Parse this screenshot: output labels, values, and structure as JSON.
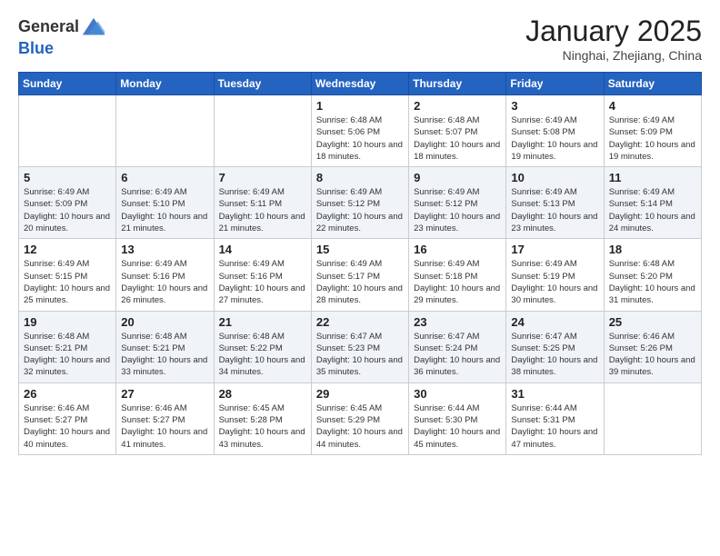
{
  "header": {
    "logo_general": "General",
    "logo_blue": "Blue",
    "month_title": "January 2025",
    "location": "Ninghai, Zhejiang, China"
  },
  "days_of_week": [
    "Sunday",
    "Monday",
    "Tuesday",
    "Wednesday",
    "Thursday",
    "Friday",
    "Saturday"
  ],
  "weeks": [
    [
      {
        "day": "",
        "info": ""
      },
      {
        "day": "",
        "info": ""
      },
      {
        "day": "",
        "info": ""
      },
      {
        "day": "1",
        "info": "Sunrise: 6:48 AM\nSunset: 5:06 PM\nDaylight: 10 hours and 18 minutes."
      },
      {
        "day": "2",
        "info": "Sunrise: 6:48 AM\nSunset: 5:07 PM\nDaylight: 10 hours and 18 minutes."
      },
      {
        "day": "3",
        "info": "Sunrise: 6:49 AM\nSunset: 5:08 PM\nDaylight: 10 hours and 19 minutes."
      },
      {
        "day": "4",
        "info": "Sunrise: 6:49 AM\nSunset: 5:09 PM\nDaylight: 10 hours and 19 minutes."
      }
    ],
    [
      {
        "day": "5",
        "info": "Sunrise: 6:49 AM\nSunset: 5:09 PM\nDaylight: 10 hours and 20 minutes."
      },
      {
        "day": "6",
        "info": "Sunrise: 6:49 AM\nSunset: 5:10 PM\nDaylight: 10 hours and 21 minutes."
      },
      {
        "day": "7",
        "info": "Sunrise: 6:49 AM\nSunset: 5:11 PM\nDaylight: 10 hours and 21 minutes."
      },
      {
        "day": "8",
        "info": "Sunrise: 6:49 AM\nSunset: 5:12 PM\nDaylight: 10 hours and 22 minutes."
      },
      {
        "day": "9",
        "info": "Sunrise: 6:49 AM\nSunset: 5:12 PM\nDaylight: 10 hours and 23 minutes."
      },
      {
        "day": "10",
        "info": "Sunrise: 6:49 AM\nSunset: 5:13 PM\nDaylight: 10 hours and 23 minutes."
      },
      {
        "day": "11",
        "info": "Sunrise: 6:49 AM\nSunset: 5:14 PM\nDaylight: 10 hours and 24 minutes."
      }
    ],
    [
      {
        "day": "12",
        "info": "Sunrise: 6:49 AM\nSunset: 5:15 PM\nDaylight: 10 hours and 25 minutes."
      },
      {
        "day": "13",
        "info": "Sunrise: 6:49 AM\nSunset: 5:16 PM\nDaylight: 10 hours and 26 minutes."
      },
      {
        "day": "14",
        "info": "Sunrise: 6:49 AM\nSunset: 5:16 PM\nDaylight: 10 hours and 27 minutes."
      },
      {
        "day": "15",
        "info": "Sunrise: 6:49 AM\nSunset: 5:17 PM\nDaylight: 10 hours and 28 minutes."
      },
      {
        "day": "16",
        "info": "Sunrise: 6:49 AM\nSunset: 5:18 PM\nDaylight: 10 hours and 29 minutes."
      },
      {
        "day": "17",
        "info": "Sunrise: 6:49 AM\nSunset: 5:19 PM\nDaylight: 10 hours and 30 minutes."
      },
      {
        "day": "18",
        "info": "Sunrise: 6:48 AM\nSunset: 5:20 PM\nDaylight: 10 hours and 31 minutes."
      }
    ],
    [
      {
        "day": "19",
        "info": "Sunrise: 6:48 AM\nSunset: 5:21 PM\nDaylight: 10 hours and 32 minutes."
      },
      {
        "day": "20",
        "info": "Sunrise: 6:48 AM\nSunset: 5:21 PM\nDaylight: 10 hours and 33 minutes."
      },
      {
        "day": "21",
        "info": "Sunrise: 6:48 AM\nSunset: 5:22 PM\nDaylight: 10 hours and 34 minutes."
      },
      {
        "day": "22",
        "info": "Sunrise: 6:47 AM\nSunset: 5:23 PM\nDaylight: 10 hours and 35 minutes."
      },
      {
        "day": "23",
        "info": "Sunrise: 6:47 AM\nSunset: 5:24 PM\nDaylight: 10 hours and 36 minutes."
      },
      {
        "day": "24",
        "info": "Sunrise: 6:47 AM\nSunset: 5:25 PM\nDaylight: 10 hours and 38 minutes."
      },
      {
        "day": "25",
        "info": "Sunrise: 6:46 AM\nSunset: 5:26 PM\nDaylight: 10 hours and 39 minutes."
      }
    ],
    [
      {
        "day": "26",
        "info": "Sunrise: 6:46 AM\nSunset: 5:27 PM\nDaylight: 10 hours and 40 minutes."
      },
      {
        "day": "27",
        "info": "Sunrise: 6:46 AM\nSunset: 5:27 PM\nDaylight: 10 hours and 41 minutes."
      },
      {
        "day": "28",
        "info": "Sunrise: 6:45 AM\nSunset: 5:28 PM\nDaylight: 10 hours and 43 minutes."
      },
      {
        "day": "29",
        "info": "Sunrise: 6:45 AM\nSunset: 5:29 PM\nDaylight: 10 hours and 44 minutes."
      },
      {
        "day": "30",
        "info": "Sunrise: 6:44 AM\nSunset: 5:30 PM\nDaylight: 10 hours and 45 minutes."
      },
      {
        "day": "31",
        "info": "Sunrise: 6:44 AM\nSunset: 5:31 PM\nDaylight: 10 hours and 47 minutes."
      },
      {
        "day": "",
        "info": ""
      }
    ]
  ]
}
